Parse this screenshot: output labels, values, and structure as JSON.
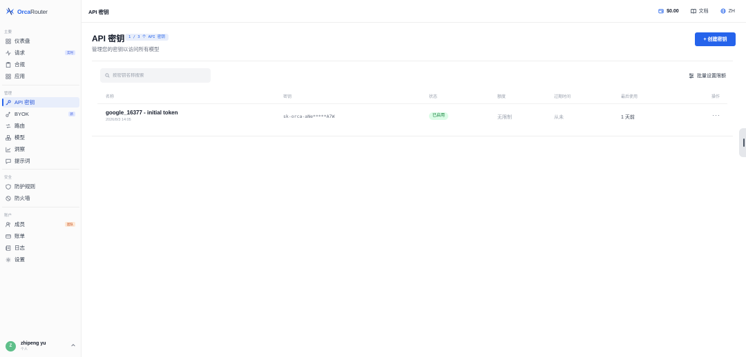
{
  "brand": {
    "name_part1": "Orca",
    "name_part2": "Router"
  },
  "topbar": {
    "breadcrumb": "API 密钥",
    "balance": "$0.00",
    "docs": "文档",
    "language": "ZH"
  },
  "sidebar": {
    "sections": {
      "main": "主要",
      "manage": "管理",
      "security": "安全",
      "account": "账户"
    },
    "items": {
      "dashboard": "仪表盘",
      "requests": "请求",
      "compliance": "合规",
      "apps": "应用",
      "api_keys": "API 密钥",
      "byok": "BYOK",
      "routing": "路由",
      "models": "模型",
      "insights": "洞察",
      "prompts": "提示词",
      "guard_rules": "防护规则",
      "firewall": "防火墙",
      "members": "成员",
      "billing": "账单",
      "logs": "日志",
      "settings": "设置"
    },
    "badges": {
      "requests": "实时",
      "byok": "新",
      "members": "团队"
    },
    "user": {
      "initial": "Z",
      "name": "zhipeng yu",
      "role": "个人"
    }
  },
  "page": {
    "title": "API 密钥",
    "count": "1 / 3 个 API 密钥",
    "subtitle": "管理您的密钥以访问所有模型",
    "create_button": "+ 创建密钥",
    "search_placeholder": "按密钥名称搜索",
    "bulk_limit": "批量设置限额"
  },
  "table": {
    "headers": [
      "名称",
      "密钥",
      "状态",
      "额度",
      "过期时间",
      "最后使用",
      "操作"
    ],
    "rows": [
      {
        "name": "google_16377 - initial token",
        "created": "2026/8/3 14:05",
        "key": "sk-orca-aNe*****A7W",
        "status": "已启用",
        "limit": "无限制",
        "expiry": "从未",
        "last_used": "1 天前",
        "actions": "···"
      }
    ]
  },
  "colors": {
    "accent": "#2563eb",
    "status_ok_bg": "#dcfce7",
    "status_ok_text": "#15803d"
  }
}
